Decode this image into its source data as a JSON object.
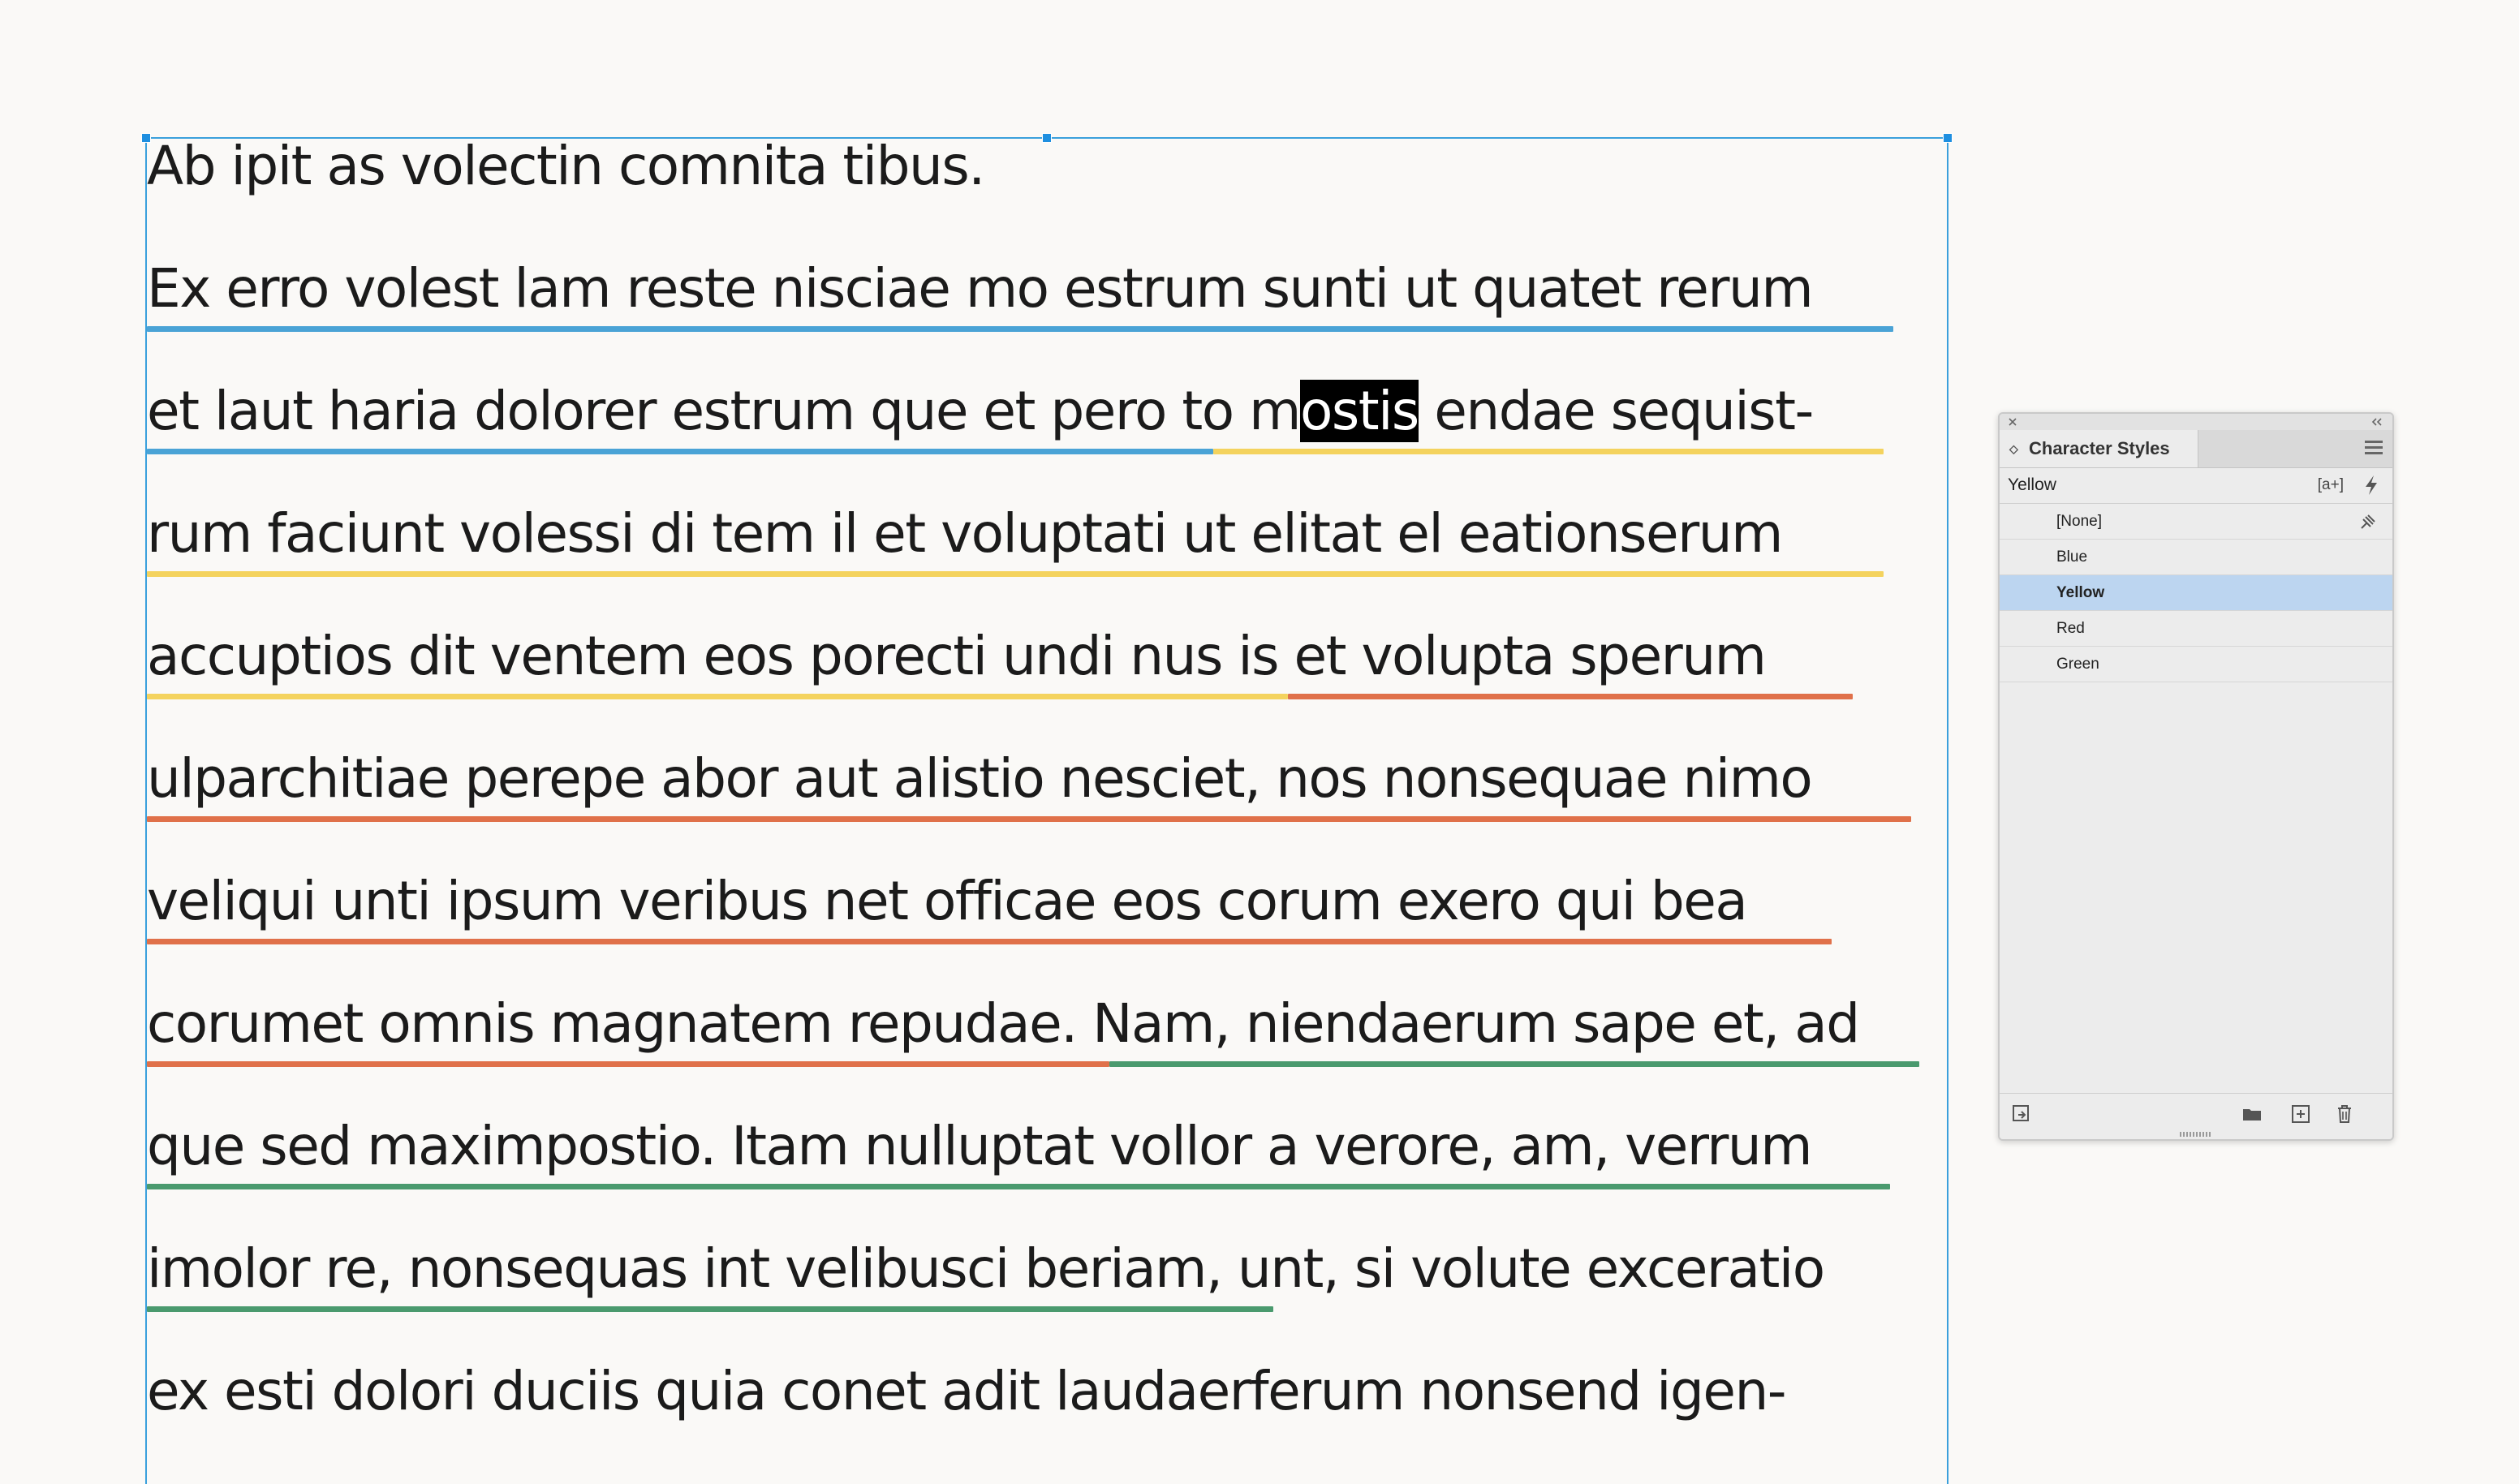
{
  "document": {
    "lines": [
      {
        "segments": [
          {
            "text": "Ab ipit as volectin comnita tibus."
          }
        ]
      },
      {
        "segments": [
          {
            "text": "Ex erro volest lam reste nisciae mo estrum sunti ut quatet rerum"
          }
        ]
      },
      {
        "segments": [
          {
            "text": "et laut haria dolorer estrum que et pero to m"
          },
          {
            "text": "ostis",
            "selected": true
          },
          {
            "text": " endae sequist-"
          }
        ]
      },
      {
        "segments": [
          {
            "text": "rum faciunt volessi di tem il et voluptati ut elitat el eationserum"
          }
        ]
      },
      {
        "segments": [
          {
            "text": "accuptios dit ventem eos porecti undi nus is et volupta sperum"
          }
        ]
      },
      {
        "segments": [
          {
            "text": "ulparchitiae perepe abor aut alistio nesciet, nos nonsequae nimo"
          }
        ]
      },
      {
        "segments": [
          {
            "text": "veliqui unti ipsum veribus net officae eos corum exero qui bea"
          }
        ]
      },
      {
        "segments": [
          {
            "text": "corumet omnis magnatem repudae. Nam, niendaerum sape et, ad"
          }
        ]
      },
      {
        "segments": [
          {
            "text": "que sed maximpostio. Itam nulluptat vollor a verore, am, verrum"
          }
        ]
      },
      {
        "segments": [
          {
            "text": "imolor re, nonsequas int velibusci beriam, unt, si volute exceratio"
          }
        ]
      },
      {
        "segments": [
          {
            "text": "ex esti dolori duciis quia conet adit laudaerferum nonsend igen-"
          }
        ]
      }
    ],
    "underline_colors": {
      "blue": "#4aa3d6",
      "yellow": "#f4d35e",
      "red": "#e0714a",
      "green": "#4a9a6e"
    },
    "selection_color": "#000000"
  },
  "panel": {
    "title": "Character Styles",
    "current_style": "Yellow",
    "override_label": "[a+]",
    "styles": [
      {
        "label": "[None]"
      },
      {
        "label": "Blue"
      },
      {
        "label": "Yellow",
        "selected": true
      },
      {
        "label": "Red"
      },
      {
        "label": "Green"
      }
    ],
    "selected_color": "#bcd5f0",
    "icons": [
      "close-icon",
      "collapse-icon",
      "panel-menu-icon",
      "quick-apply-icon",
      "pin-icon",
      "load-styles-icon",
      "new-group-icon",
      "new-style-icon",
      "delete-icon"
    ]
  }
}
